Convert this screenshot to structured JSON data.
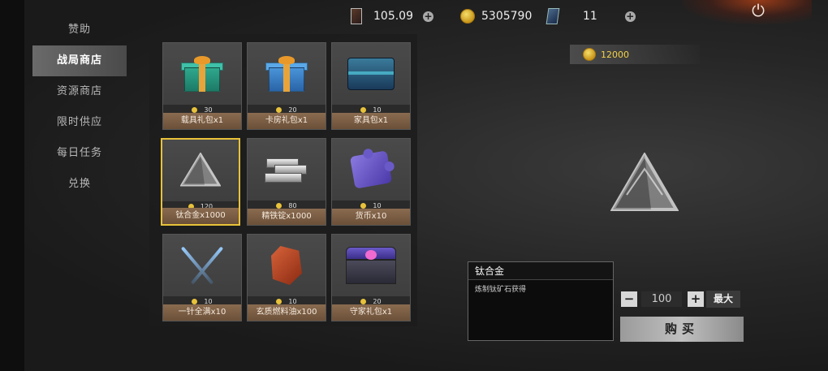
{
  "topbar": {
    "cards_value": "105.09",
    "coins_value": "5305790",
    "tickets_value": "11"
  },
  "sidebar": {
    "items": [
      {
        "label": "赞助"
      },
      {
        "label": "战局商店"
      },
      {
        "label": "资源商店"
      },
      {
        "label": "限时供应"
      },
      {
        "label": "每日任务"
      },
      {
        "label": "兑换"
      }
    ],
    "active_index": 1
  },
  "shop": {
    "items": [
      {
        "name": "载具礼包x1",
        "price": "30",
        "icon": "teal-gift-box-icon"
      },
      {
        "name": "卡房礼包x1",
        "price": "20",
        "icon": "blue-gift-box-icon"
      },
      {
        "name": "家具包x1",
        "price": "10",
        "icon": "furniture-chest-icon"
      },
      {
        "name": "钛合金x1000",
        "price": "120",
        "icon": "titanium-pyramid-icon"
      },
      {
        "name": "精铁锭x1000",
        "price": "80",
        "icon": "iron-ingot-icon"
      },
      {
        "name": "货币x10",
        "price": "10",
        "icon": "currency-puzzle-icon"
      },
      {
        "name": "一针全满x10",
        "price": "10",
        "icon": "syringe-icon"
      },
      {
        "name": "玄质燃料油x100",
        "price": "10",
        "icon": "fuel-crystal-icon"
      },
      {
        "name": "守家礼包x1",
        "price": "20",
        "icon": "guard-chest-icon"
      }
    ],
    "selected_index": 3
  },
  "detail": {
    "total_price": "12000",
    "title": "钛合金",
    "description": "炼制钛矿石获得",
    "quantity": "100",
    "max_label": "最大",
    "buy_label": "购买"
  },
  "colors": {
    "accent_gold": "#e8c23a",
    "name_bar": "#7a5c44"
  }
}
